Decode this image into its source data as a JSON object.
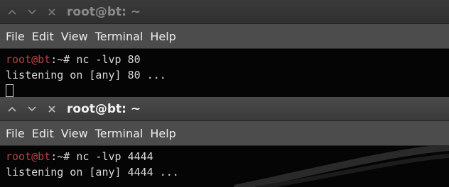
{
  "windows": [
    {
      "title": "root@bt: ~",
      "buttons": [
        "chevron-up-icon",
        "chevron-down-icon",
        "close-icon"
      ],
      "menu": [
        "File",
        "Edit",
        "View",
        "Terminal",
        "Help"
      ],
      "lines": [
        {
          "user": "root@bt",
          "rest": ":~# nc -lvp 80"
        },
        {
          "text": "listening on [any] 80 ..."
        }
      ],
      "active": false
    },
    {
      "title": "root@bt: ~",
      "buttons": [
        "chevron-up-icon",
        "chevron-down-icon",
        "close-icon"
      ],
      "menu": [
        "File",
        "Edit",
        "View",
        "Terminal",
        "Help"
      ],
      "lines": [
        {
          "user": "root@bt",
          "rest": ":~# nc -lvp 4444"
        },
        {
          "text": "listening on [any] 4444 ..."
        }
      ],
      "active": true
    }
  ],
  "colors": {
    "prompt_user": "#b84141",
    "terminal_bg": "#050505",
    "menubar_bg": "#4c4c4c",
    "titlebar_bg": "#3a3a3a"
  }
}
